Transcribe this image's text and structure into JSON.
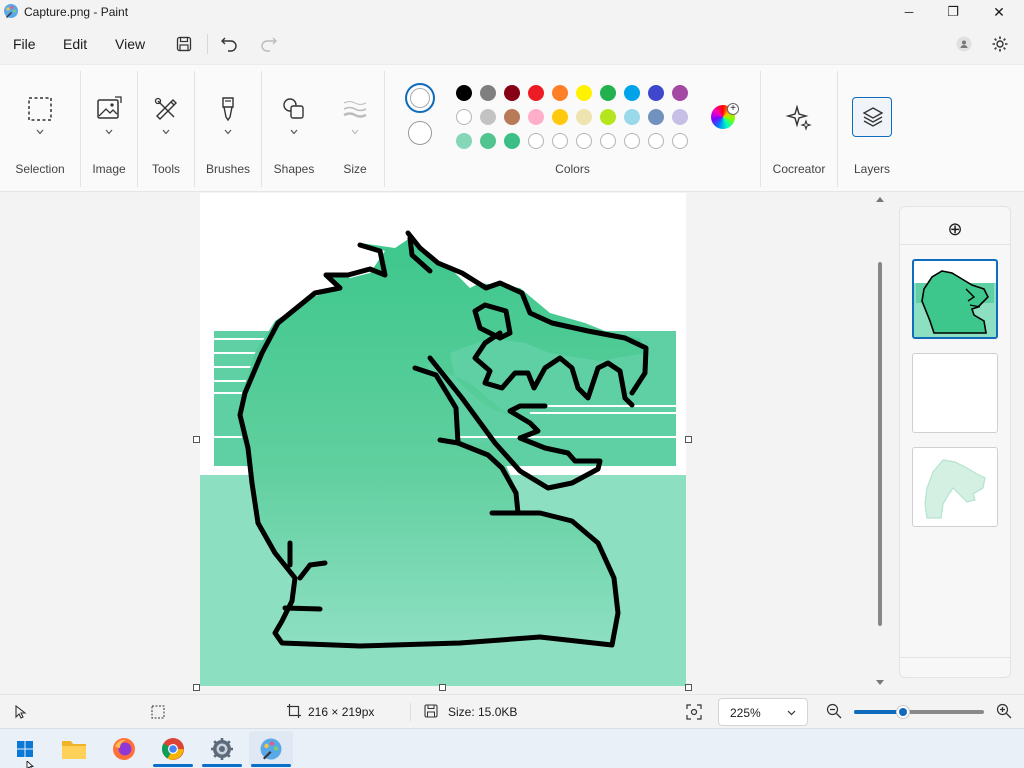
{
  "window": {
    "title": "Capture.png - Paint",
    "minimize_glyph": "─",
    "maximize_glyph": "❐",
    "close_glyph": "✕"
  },
  "menu": {
    "file": "File",
    "edit": "Edit",
    "view": "View"
  },
  "ribbon": {
    "groups": {
      "selection": "Selection",
      "image": "Image",
      "tools": "Tools",
      "brushes": "Brushes",
      "shapes": "Shapes",
      "size": "Size",
      "colors": "Colors",
      "cocreator": "Cocreator",
      "layers": "Layers"
    },
    "palette": {
      "row1": [
        "#000000",
        "#7f7f7f",
        "#880015",
        "#ed1c24",
        "#ff7f27",
        "#fff200",
        "#22b14c",
        "#00a2e8",
        "#3f48cc",
        "#a349a4"
      ],
      "row2": [
        "#ffffff",
        "#c3c3c3",
        "#b97a57",
        "#ffaec9",
        "#ffc90e",
        "#efe4b0",
        "#b5e61d",
        "#99d9ea",
        "#7092be",
        "#c8bfe7"
      ],
      "row3": [
        "#86d6b8",
        "#52c490",
        "#3cbf87",
        "#ffffff",
        "#ffffff",
        "#ffffff",
        "#ffffff",
        "#ffffff",
        "#ffffff",
        "#ffffff"
      ]
    }
  },
  "layers_panel": {
    "add_glyph": "⊕"
  },
  "status": {
    "dimensions": "216 × 219px",
    "size": "Size: 15.0KB",
    "zoom": "225%",
    "zoom_level_percent": 38
  },
  "colors": {
    "accent": "#0f6cbd",
    "fill_light": "#8ddfc2",
    "fill_dark": "#3ec78d"
  },
  "taskbar": {
    "items": [
      "start",
      "file-explorer",
      "firefox",
      "chrome",
      "settings",
      "paint"
    ]
  }
}
